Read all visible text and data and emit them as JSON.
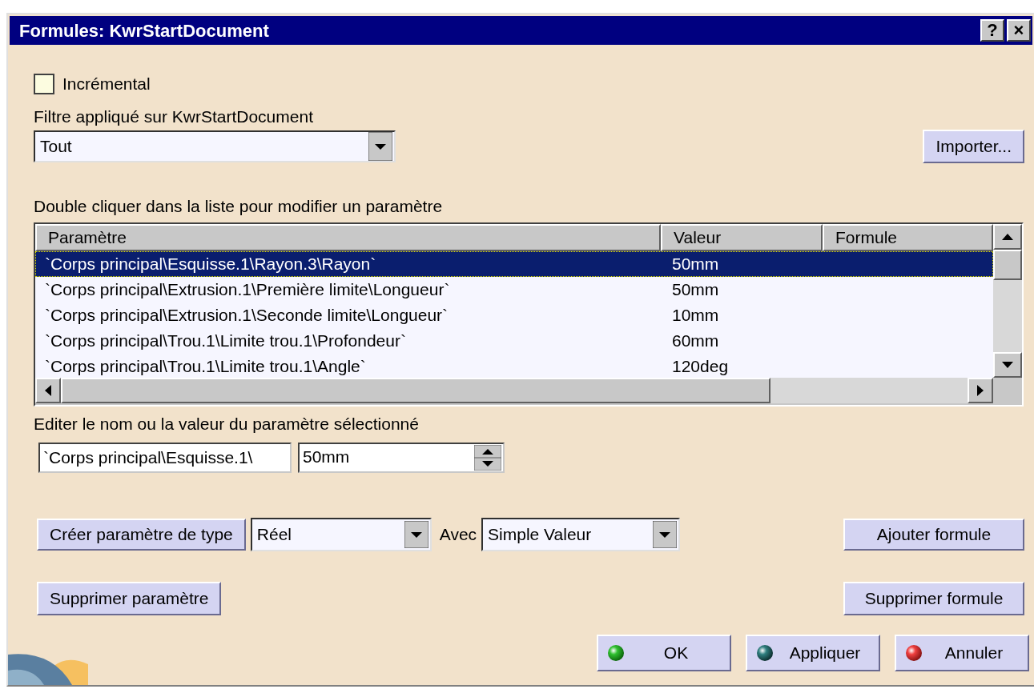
{
  "window": {
    "title": "Formules: KwrStartDocument",
    "controls": [
      "?",
      "×"
    ]
  },
  "incremental": {
    "label": "Incrémental",
    "checked": false
  },
  "filter": {
    "label": "Filtre appliqué sur KwrStartDocument",
    "value": "Tout"
  },
  "import_button": "Importer...",
  "list": {
    "caption": "Double cliquer dans la liste pour modifier un paramètre",
    "columns": [
      "Paramètre",
      "Valeur",
      "Formule"
    ],
    "rows": [
      {
        "parameter": "`Corps principal\\Esquisse.1\\Rayon.3\\Rayon`",
        "value": "50mm",
        "selected": true
      },
      {
        "parameter": "`Corps principal\\Extrusion.1\\Première limite\\Longueur`",
        "value": "50mm",
        "selected": false
      },
      {
        "parameter": "`Corps principal\\Extrusion.1\\Seconde limite\\Longueur`",
        "value": "10mm",
        "selected": false
      },
      {
        "parameter": "`Corps principal\\Trou.1\\Limite trou.1\\Profondeur`",
        "value": "60mm",
        "selected": false
      },
      {
        "parameter": "`Corps principal\\Trou.1\\Limite trou.1\\Angle`",
        "value": "120deg",
        "selected": false
      }
    ]
  },
  "edit": {
    "caption": "Editer le nom ou la valeur du paramètre sélectionné",
    "name": "`Corps principal\\Esquisse.1\\",
    "value": "50mm"
  },
  "create": {
    "button": "Créer paramètre de type",
    "type": "Réel",
    "with_label": "Avec",
    "with_value": "Simple Valeur"
  },
  "add_formula": "Ajouter formule",
  "delete_parameter": "Supprimer paramètre",
  "delete_formula": "Supprimer formule",
  "dialog_buttons": [
    {
      "kind": "ok",
      "label": "OK"
    },
    {
      "kind": "apply",
      "label": "Appliquer"
    },
    {
      "kind": "cancel",
      "label": "Annuler"
    }
  ]
}
